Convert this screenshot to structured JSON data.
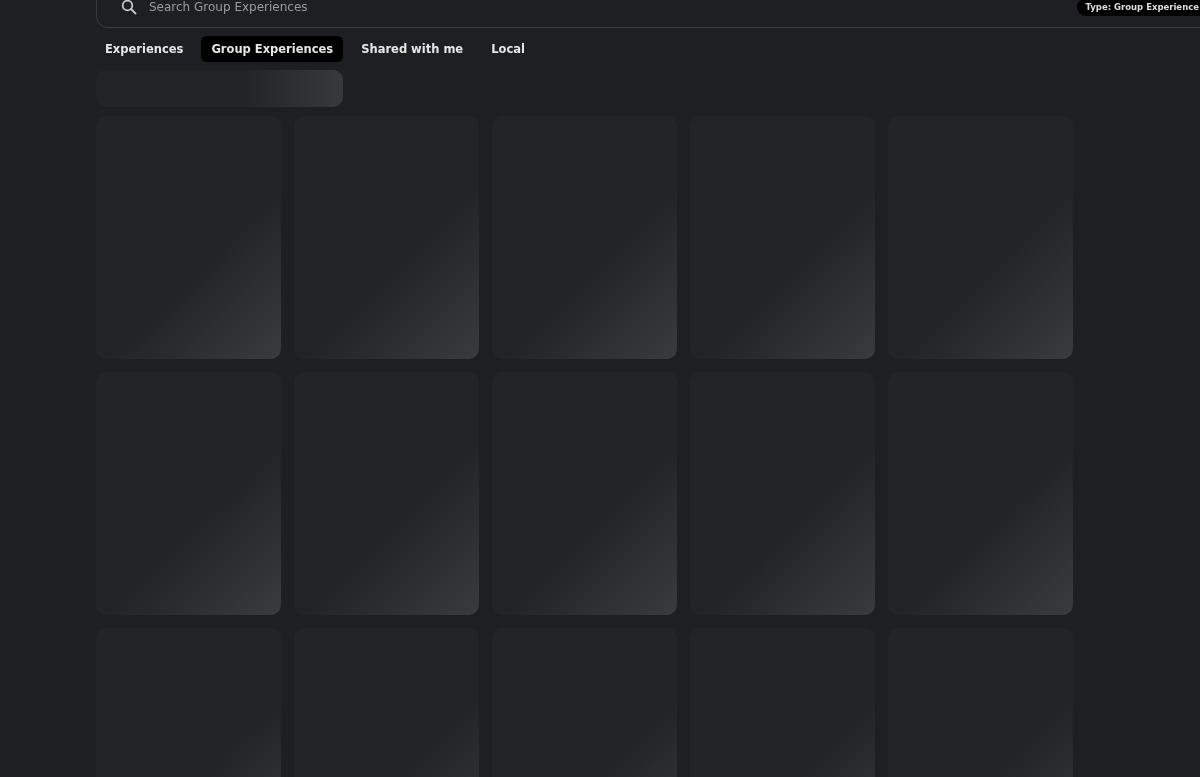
{
  "search": {
    "placeholder": "Search Group Experiences",
    "filter_chip": "Type: Group Experience"
  },
  "tabs": [
    {
      "label": "Experiences",
      "selected": false
    },
    {
      "label": "Group Experiences",
      "selected": true
    },
    {
      "label": "Shared with me",
      "selected": false
    },
    {
      "label": "Local",
      "selected": false
    }
  ],
  "header_placeholder": {
    "kind": "skeleton"
  },
  "cards": [
    {
      "kind": "skeleton"
    },
    {
      "kind": "skeleton"
    },
    {
      "kind": "skeleton"
    },
    {
      "kind": "skeleton"
    },
    {
      "kind": "skeleton"
    },
    {
      "kind": "skeleton"
    },
    {
      "kind": "skeleton"
    },
    {
      "kind": "skeleton"
    },
    {
      "kind": "skeleton"
    },
    {
      "kind": "skeleton"
    },
    {
      "kind": "skeleton"
    },
    {
      "kind": "skeleton"
    },
    {
      "kind": "skeleton"
    },
    {
      "kind": "skeleton"
    },
    {
      "kind": "skeleton"
    }
  ]
}
